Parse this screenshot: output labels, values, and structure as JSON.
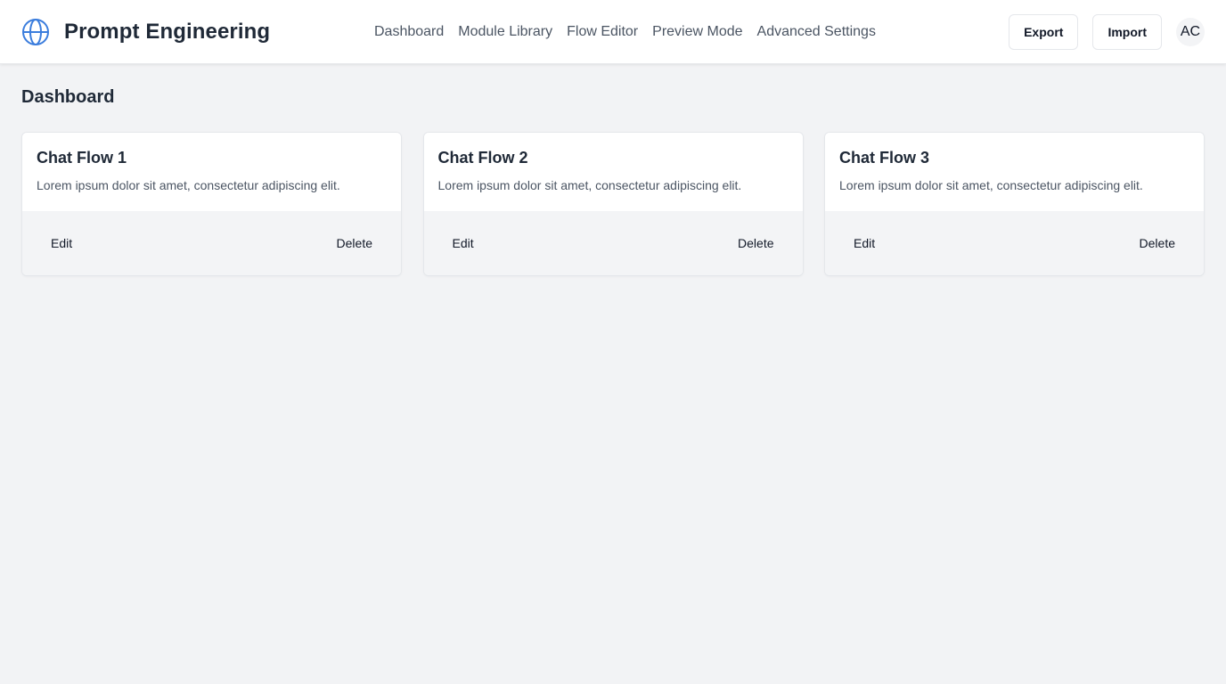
{
  "header": {
    "brand_title": "Prompt Engineering",
    "brand_icon": "globe-icon",
    "accent_color": "#3b7ddd",
    "nav": [
      {
        "label": "Dashboard"
      },
      {
        "label": "Module Library"
      },
      {
        "label": "Flow Editor"
      },
      {
        "label": "Preview Mode"
      },
      {
        "label": "Advanced Settings"
      }
    ],
    "export_label": "Export",
    "import_label": "Import",
    "avatar_initials": "AC"
  },
  "main": {
    "page_title": "Dashboard",
    "cards": [
      {
        "title": "Chat Flow 1",
        "description": "Lorem ipsum dolor sit amet, consectetur adipiscing elit.",
        "edit_label": "Edit",
        "delete_label": "Delete"
      },
      {
        "title": "Chat Flow 2",
        "description": "Lorem ipsum dolor sit amet, consectetur adipiscing elit.",
        "edit_label": "Edit",
        "delete_label": "Delete"
      },
      {
        "title": "Chat Flow 3",
        "description": "Lorem ipsum dolor sit amet, consectetur adipiscing elit.",
        "edit_label": "Edit",
        "delete_label": "Delete"
      }
    ]
  }
}
